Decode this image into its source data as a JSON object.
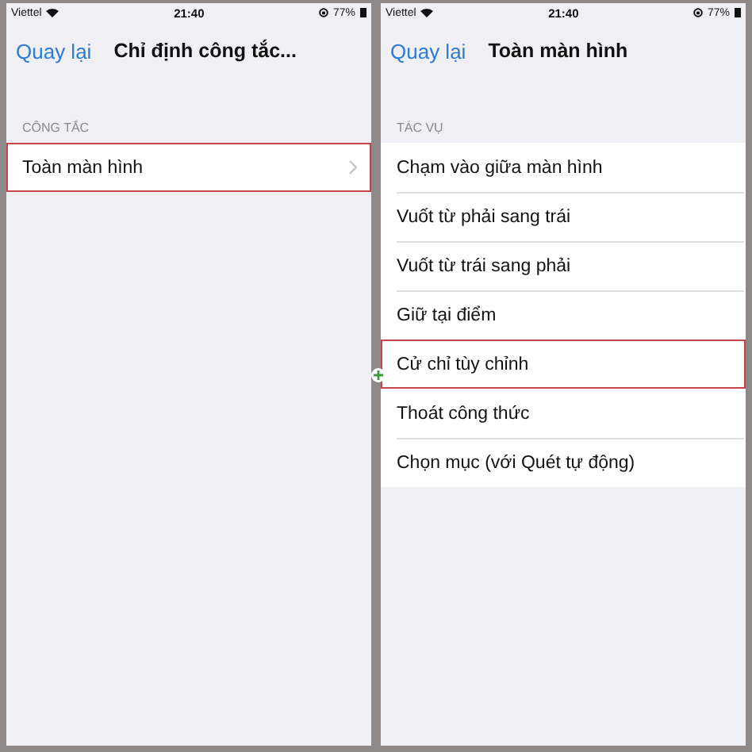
{
  "screens": [
    {
      "status_bar": {
        "carrier": "Viettel",
        "time": "21:40",
        "battery": "77%"
      },
      "nav": {
        "back": "Quay lại",
        "title": "Chỉ định công tắc..."
      },
      "section": "CÔNG TẮC",
      "items": [
        {
          "label": "Toàn màn hình",
          "chevron": true,
          "highlighted": true
        }
      ]
    },
    {
      "status_bar": {
        "carrier": "Viettel",
        "time": "21:40",
        "battery": "77%"
      },
      "nav": {
        "back": "Quay lại",
        "title": "Toàn màn hình"
      },
      "section": "TÁC VỤ",
      "items": [
        {
          "label": "Chạm vào giữa màn hình",
          "chevron": false,
          "highlighted": false
        },
        {
          "label": "Vuốt từ phải sang trái",
          "chevron": false,
          "highlighted": false
        },
        {
          "label": "Vuốt từ trái sang phải",
          "chevron": false,
          "highlighted": false
        },
        {
          "label": "Giữ tại điểm",
          "chevron": false,
          "highlighted": false
        },
        {
          "label": "Cử chỉ tùy chỉnh",
          "chevron": false,
          "highlighted": true
        },
        {
          "label": "Thoát công thức",
          "chevron": false,
          "highlighted": false
        },
        {
          "label": "Chọn mục (với Quét tự động)",
          "chevron": false,
          "highlighted": false
        }
      ]
    }
  ]
}
